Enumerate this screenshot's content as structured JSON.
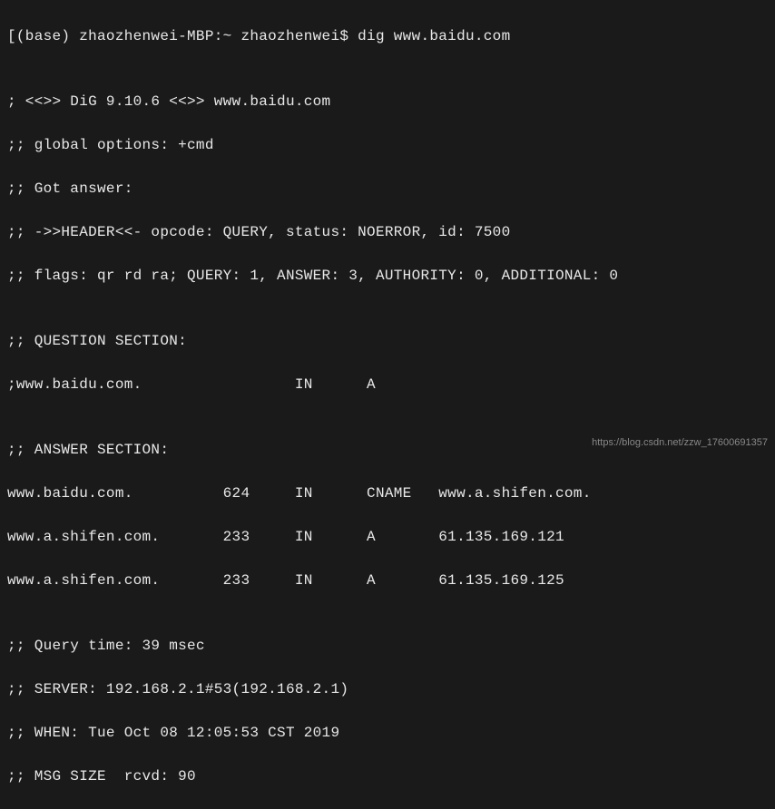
{
  "prompt": "[(base) zhaozhenwei-MBP:~ zhaozhenwei$ dig www.baidu.com",
  "blank": "",
  "dig_banner": "; <<>> DiG 9.10.6 <<>> www.baidu.com",
  "global_options": ";; global options: +cmd",
  "got_answer": ";; Got answer:",
  "header": ";; ->>HEADER<<- opcode: QUERY, status: NOERROR, id: 7500",
  "flags": ";; flags: qr rd ra; QUERY: 1, ANSWER: 3, AUTHORITY: 0, ADDITIONAL: 0",
  "question_header": ";; QUESTION SECTION:",
  "question_row": ";www.baidu.com.                 IN      A",
  "answer_header": ";; ANSWER SECTION:",
  "answer_row1": "www.baidu.com.          624     IN      CNAME   www.a.shifen.com.",
  "answer_row2": "www.a.shifen.com.       233     IN      A       61.135.169.121",
  "answer_row3": "www.a.shifen.com.       233     IN      A       61.135.169.125",
  "query_time": ";; Query time: 39 msec",
  "server": ";; SERVER: 192.168.2.1#53(192.168.2.1)",
  "when": ";; WHEN: Tue Oct 08 12:05:53 CST 2019",
  "msg_size": ";; MSG SIZE  rcvd: 90",
  "watermark": "https://blog.csdn.net/zzw_17600691357"
}
